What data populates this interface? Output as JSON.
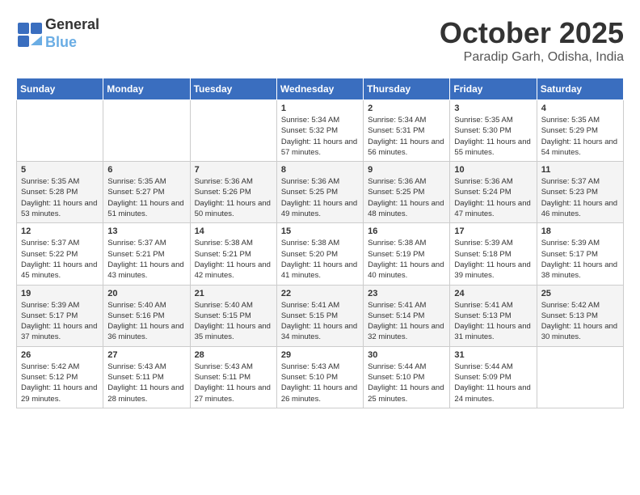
{
  "logo": {
    "line1": "General",
    "line2": "Blue"
  },
  "title": "October 2025",
  "location": "Paradip Garh, Odisha, India",
  "days_of_week": [
    "Sunday",
    "Monday",
    "Tuesday",
    "Wednesday",
    "Thursday",
    "Friday",
    "Saturday"
  ],
  "weeks": [
    [
      {
        "day": "",
        "content": ""
      },
      {
        "day": "",
        "content": ""
      },
      {
        "day": "",
        "content": ""
      },
      {
        "day": "1",
        "content": "Sunrise: 5:34 AM\nSunset: 5:32 PM\nDaylight: 11 hours and 57 minutes."
      },
      {
        "day": "2",
        "content": "Sunrise: 5:34 AM\nSunset: 5:31 PM\nDaylight: 11 hours and 56 minutes."
      },
      {
        "day": "3",
        "content": "Sunrise: 5:35 AM\nSunset: 5:30 PM\nDaylight: 11 hours and 55 minutes."
      },
      {
        "day": "4",
        "content": "Sunrise: 5:35 AM\nSunset: 5:29 PM\nDaylight: 11 hours and 54 minutes."
      }
    ],
    [
      {
        "day": "5",
        "content": "Sunrise: 5:35 AM\nSunset: 5:28 PM\nDaylight: 11 hours and 53 minutes."
      },
      {
        "day": "6",
        "content": "Sunrise: 5:35 AM\nSunset: 5:27 PM\nDaylight: 11 hours and 51 minutes."
      },
      {
        "day": "7",
        "content": "Sunrise: 5:36 AM\nSunset: 5:26 PM\nDaylight: 11 hours and 50 minutes."
      },
      {
        "day": "8",
        "content": "Sunrise: 5:36 AM\nSunset: 5:25 PM\nDaylight: 11 hours and 49 minutes."
      },
      {
        "day": "9",
        "content": "Sunrise: 5:36 AM\nSunset: 5:25 PM\nDaylight: 11 hours and 48 minutes."
      },
      {
        "day": "10",
        "content": "Sunrise: 5:36 AM\nSunset: 5:24 PM\nDaylight: 11 hours and 47 minutes."
      },
      {
        "day": "11",
        "content": "Sunrise: 5:37 AM\nSunset: 5:23 PM\nDaylight: 11 hours and 46 minutes."
      }
    ],
    [
      {
        "day": "12",
        "content": "Sunrise: 5:37 AM\nSunset: 5:22 PM\nDaylight: 11 hours and 45 minutes."
      },
      {
        "day": "13",
        "content": "Sunrise: 5:37 AM\nSunset: 5:21 PM\nDaylight: 11 hours and 43 minutes."
      },
      {
        "day": "14",
        "content": "Sunrise: 5:38 AM\nSunset: 5:21 PM\nDaylight: 11 hours and 42 minutes."
      },
      {
        "day": "15",
        "content": "Sunrise: 5:38 AM\nSunset: 5:20 PM\nDaylight: 11 hours and 41 minutes."
      },
      {
        "day": "16",
        "content": "Sunrise: 5:38 AM\nSunset: 5:19 PM\nDaylight: 11 hours and 40 minutes."
      },
      {
        "day": "17",
        "content": "Sunrise: 5:39 AM\nSunset: 5:18 PM\nDaylight: 11 hours and 39 minutes."
      },
      {
        "day": "18",
        "content": "Sunrise: 5:39 AM\nSunset: 5:17 PM\nDaylight: 11 hours and 38 minutes."
      }
    ],
    [
      {
        "day": "19",
        "content": "Sunrise: 5:39 AM\nSunset: 5:17 PM\nDaylight: 11 hours and 37 minutes."
      },
      {
        "day": "20",
        "content": "Sunrise: 5:40 AM\nSunset: 5:16 PM\nDaylight: 11 hours and 36 minutes."
      },
      {
        "day": "21",
        "content": "Sunrise: 5:40 AM\nSunset: 5:15 PM\nDaylight: 11 hours and 35 minutes."
      },
      {
        "day": "22",
        "content": "Sunrise: 5:41 AM\nSunset: 5:15 PM\nDaylight: 11 hours and 34 minutes."
      },
      {
        "day": "23",
        "content": "Sunrise: 5:41 AM\nSunset: 5:14 PM\nDaylight: 11 hours and 32 minutes."
      },
      {
        "day": "24",
        "content": "Sunrise: 5:41 AM\nSunset: 5:13 PM\nDaylight: 11 hours and 31 minutes."
      },
      {
        "day": "25",
        "content": "Sunrise: 5:42 AM\nSunset: 5:13 PM\nDaylight: 11 hours and 30 minutes."
      }
    ],
    [
      {
        "day": "26",
        "content": "Sunrise: 5:42 AM\nSunset: 5:12 PM\nDaylight: 11 hours and 29 minutes."
      },
      {
        "day": "27",
        "content": "Sunrise: 5:43 AM\nSunset: 5:11 PM\nDaylight: 11 hours and 28 minutes."
      },
      {
        "day": "28",
        "content": "Sunrise: 5:43 AM\nSunset: 5:11 PM\nDaylight: 11 hours and 27 minutes."
      },
      {
        "day": "29",
        "content": "Sunrise: 5:43 AM\nSunset: 5:10 PM\nDaylight: 11 hours and 26 minutes."
      },
      {
        "day": "30",
        "content": "Sunrise: 5:44 AM\nSunset: 5:10 PM\nDaylight: 11 hours and 25 minutes."
      },
      {
        "day": "31",
        "content": "Sunrise: 5:44 AM\nSunset: 5:09 PM\nDaylight: 11 hours and 24 minutes."
      },
      {
        "day": "",
        "content": ""
      }
    ]
  ]
}
